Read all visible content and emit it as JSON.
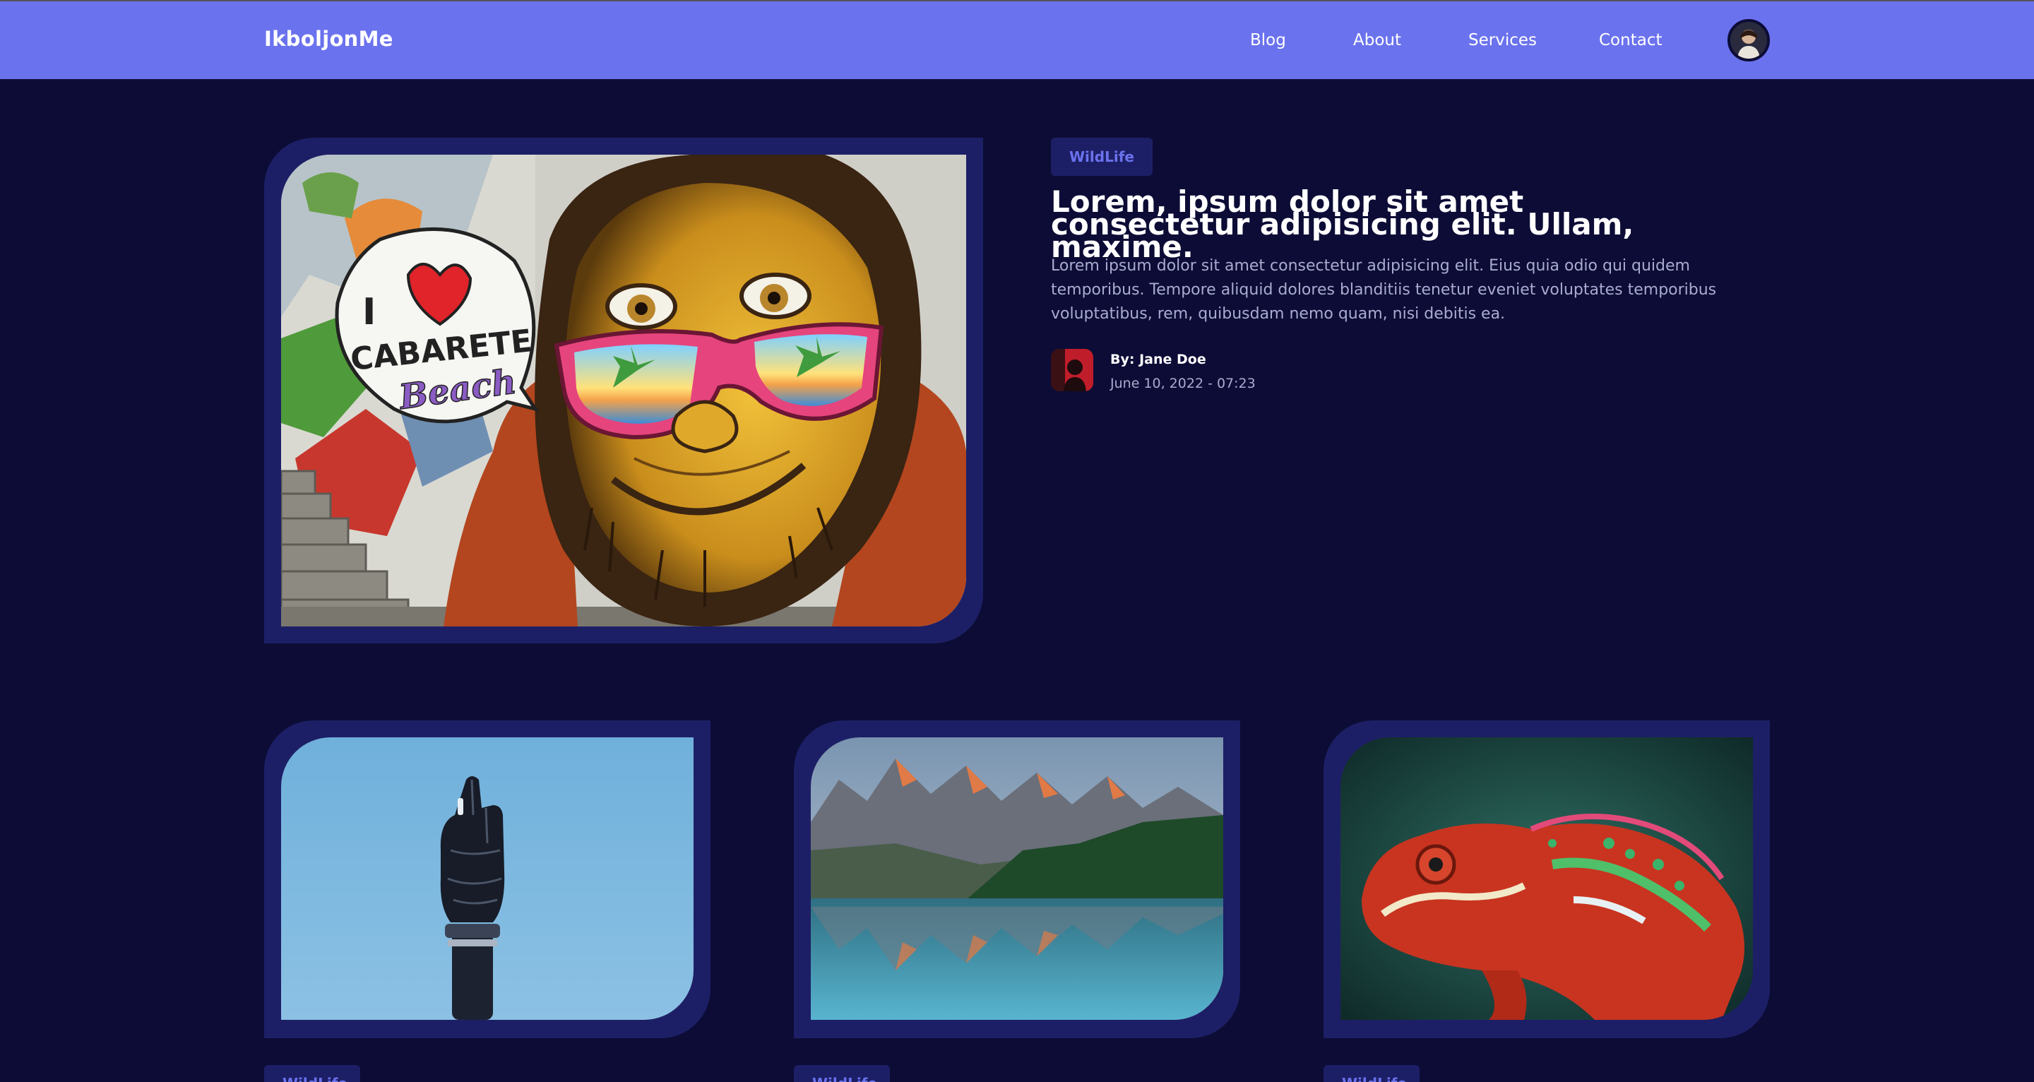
{
  "navbar": {
    "brand": "IkboljonMe",
    "links": [
      "Blog",
      "About",
      "Services",
      "Contact"
    ]
  },
  "hero": {
    "category": "WildLife",
    "title": "Lorem, ipsum dolor sit amet consectetur adipisicing elit. Ullam, maxime.",
    "description": "Lorem ipsum dolor sit amet consectetur adipisicing elit. Eius quia odio qui quidem temporibus. Tempore aliquid dolores blanditiis tenetur eveniet voluptates temporibus voluptatibus, rem, quibusdam nemo quam, nisi debitis ea.",
    "author": "By: Jane Doe",
    "date": "June 10, 2022 - 07:23",
    "image_text": [
      "I",
      "CABARETE",
      "Beach"
    ]
  },
  "cards": [
    {
      "category": "WildLife"
    },
    {
      "category": "WildLife"
    },
    {
      "category": "WildLife"
    }
  ],
  "colors": {
    "background": "#0c0c36",
    "navbar": "#6b72ee",
    "frame": "#1d1f66",
    "accent": "#6b72ee",
    "muted_text": "#a9accf"
  }
}
